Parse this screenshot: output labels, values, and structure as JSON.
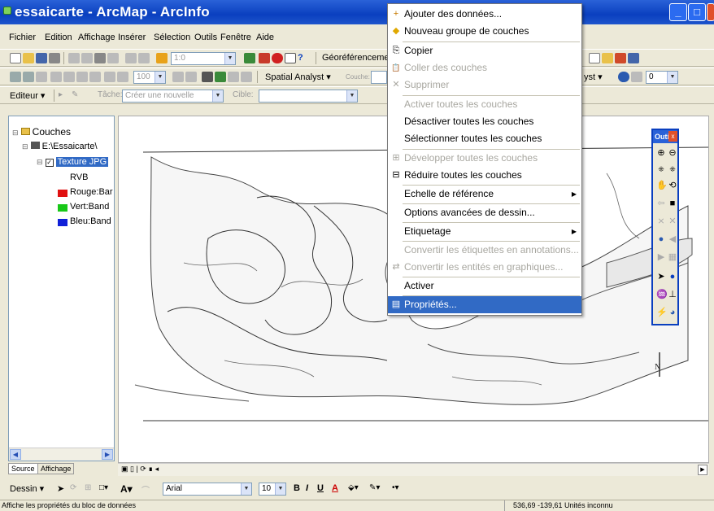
{
  "window": {
    "title": "essaicarte - ArcMap - ArcInfo",
    "controls": [
      "_",
      "□",
      "X"
    ]
  },
  "menubar": [
    "Fichier",
    "Edition",
    "Affichage",
    "Insérer",
    "Sélection",
    "Outils",
    "Fenêtre",
    "Aide"
  ],
  "toolbar1": {
    "scale_value": "1:0",
    "georef_label": "Géoréférenceme"
  },
  "toolbar2": {
    "zoom_value": "100",
    "spatial_analyst_label": "Spatial Analyst ▾",
    "layer_combo_placeholder": "Couche:",
    "right_label": "yst ▾",
    "right_combo_value": "0"
  },
  "editor_bar": {
    "editor_label": "Editeur ▾",
    "tache_label": "Tâche:",
    "tache_value": "Créer une nouvelle",
    "cible_label": "Cible:"
  },
  "toc": {
    "root": "Couches",
    "workspace": "E:\\Essaicarte\\",
    "layer": "Texture JPG",
    "rvb": "RVB",
    "bands": [
      {
        "label": "Rouge:Bar",
        "color": "#e01010"
      },
      {
        "label": "Vert:Band",
        "color": "#18c818"
      },
      {
        "label": "Bleu:Band",
        "color": "#1020d8"
      }
    ],
    "tabs": [
      "Source",
      "Affichage"
    ]
  },
  "context_menu": {
    "items": [
      {
        "label": "Ajouter des données...",
        "icon": "add-data-icon",
        "glyph": "+",
        "disabled": false
      },
      {
        "label": "Nouveau groupe de couches",
        "icon": "new-group-icon",
        "glyph": "◆",
        "disabled": false
      },
      {
        "label": "Copier",
        "icon": "copy-icon",
        "glyph": "⎘",
        "disabled": false
      },
      {
        "label": "Coller des couches",
        "icon": "paste-icon",
        "glyph": "📋",
        "disabled": true
      },
      {
        "label": "Supprimer",
        "icon": "delete-icon",
        "glyph": "✕",
        "disabled": true
      },
      {
        "label": "Activer toutes les couches",
        "icon": "",
        "glyph": "",
        "disabled": true
      },
      {
        "label": "Désactiver toutes les couches",
        "icon": "",
        "glyph": "",
        "disabled": false
      },
      {
        "label": "Sélectionner toutes les couches",
        "icon": "",
        "glyph": "",
        "disabled": false
      },
      {
        "label": "Développer toutes les couches",
        "icon": "expand-icon",
        "glyph": "⊞",
        "disabled": true
      },
      {
        "label": "Réduire toutes les couches",
        "icon": "collapse-icon",
        "glyph": "⊟",
        "disabled": false
      },
      {
        "label": "Echelle de référence",
        "icon": "",
        "glyph": "",
        "disabled": false,
        "submenu": true
      },
      {
        "label": "Options avancées de dessin...",
        "icon": "",
        "glyph": "",
        "disabled": false
      },
      {
        "label": "Etiquetage",
        "icon": "",
        "glyph": "",
        "disabled": false,
        "submenu": true
      },
      {
        "label": "Convertir les étiquettes en annotations...",
        "icon": "",
        "glyph": "",
        "disabled": true
      },
      {
        "label": "Convertir les entités en graphiques...",
        "icon": "convert-icon",
        "glyph": "⇄",
        "disabled": true
      },
      {
        "label": "Activer",
        "icon": "",
        "glyph": "",
        "disabled": false
      },
      {
        "label": "Propriétés...",
        "icon": "properties-icon",
        "glyph": "▤",
        "disabled": false,
        "highlighted": true
      }
    ]
  },
  "outils": {
    "title": "Outils",
    "close": "x"
  },
  "drawbar": {
    "dessin_label": "Dessin ▾",
    "font_value": "Arial",
    "size_value": "10",
    "bold": "B",
    "italic": "I",
    "underline": "U",
    "font_color": "A"
  },
  "statusbar": {
    "message": "Affiche les propriétés du bloc de données",
    "coordinates": "536,69  -139,61 Unités inconnu"
  },
  "map": {
    "north_label": "N"
  }
}
